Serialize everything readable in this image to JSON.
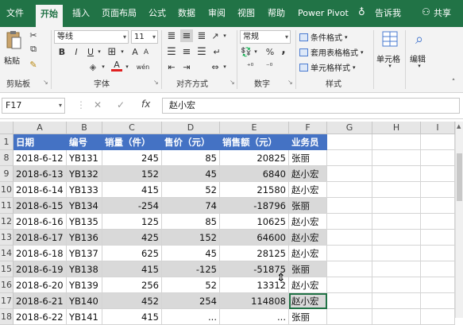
{
  "ribbon_tabs": [
    "文件",
    "开始",
    "插入",
    "页面布局",
    "公式",
    "数据",
    "审阅",
    "视图",
    "帮助",
    "Power Pivot",
    "告诉我",
    "共享"
  ],
  "active_tab": "开始",
  "clipboard": {
    "paste_label": "粘贴",
    "group_label": "剪贴板"
  },
  "font": {
    "name": "等线",
    "size": "11",
    "group_label": "字体",
    "bold": "B",
    "italic": "I",
    "underline": "U",
    "grow": "A",
    "shrink": "A",
    "color_a": "A",
    "wen": "wén"
  },
  "alignment": {
    "group_label": "对齐方式"
  },
  "number": {
    "format": "常规",
    "group_label": "数字",
    "percent": "%",
    "comma": ","
  },
  "styles": {
    "conditional": "条件格式",
    "table": "套用表格格式",
    "cell": "单元格样式",
    "group_label": "样式"
  },
  "cells_group": {
    "label": "单元格"
  },
  "editing_group": {
    "label": "编辑"
  },
  "formula_bar": {
    "name_box": "F17",
    "content": "赵小宏",
    "fx": "fx"
  },
  "grid": {
    "columns": [
      "A",
      "B",
      "C",
      "D",
      "E",
      "F",
      "G",
      "H",
      "I"
    ],
    "header_row": {
      "num": "1",
      "cells": [
        "日期",
        "编号",
        "销量（件）",
        "售价（元）",
        "销售额（元）",
        "业务员"
      ]
    },
    "rows": [
      {
        "num": "8",
        "cells": [
          "2018-6-12",
          "YB131",
          "245",
          "85",
          "20825",
          "张丽"
        ]
      },
      {
        "num": "9",
        "cells": [
          "2018-6-13",
          "YB132",
          "152",
          "45",
          "6840",
          "赵小宏"
        ]
      },
      {
        "num": "10",
        "cells": [
          "2018-6-14",
          "YB133",
          "415",
          "52",
          "21580",
          "赵小宏"
        ]
      },
      {
        "num": "11",
        "cells": [
          "2018-6-15",
          "YB134",
          "-254",
          "74",
          "-18796",
          "张丽"
        ]
      },
      {
        "num": "12",
        "cells": [
          "2018-6-16",
          "YB135",
          "125",
          "85",
          "10625",
          "赵小宏"
        ]
      },
      {
        "num": "13",
        "cells": [
          "2018-6-17",
          "YB136",
          "425",
          "152",
          "64600",
          "赵小宏"
        ]
      },
      {
        "num": "14",
        "cells": [
          "2018-6-18",
          "YB137",
          "625",
          "45",
          "28125",
          "赵小宏"
        ]
      },
      {
        "num": "15",
        "cells": [
          "2018-6-19",
          "YB138",
          "415",
          "-125",
          "-51875",
          "张丽"
        ]
      },
      {
        "num": "16",
        "cells": [
          "2018-6-20",
          "YB139",
          "256",
          "52",
          "13312",
          "赵小宏"
        ]
      },
      {
        "num": "17",
        "cells": [
          "2018-6-21",
          "YB140",
          "452",
          "254",
          "114808",
          "赵小宏"
        ]
      },
      {
        "num": "18",
        "cells": [
          "2018-6-22",
          "YB141",
          "415",
          "...",
          "...",
          "张丽"
        ]
      }
    ]
  }
}
